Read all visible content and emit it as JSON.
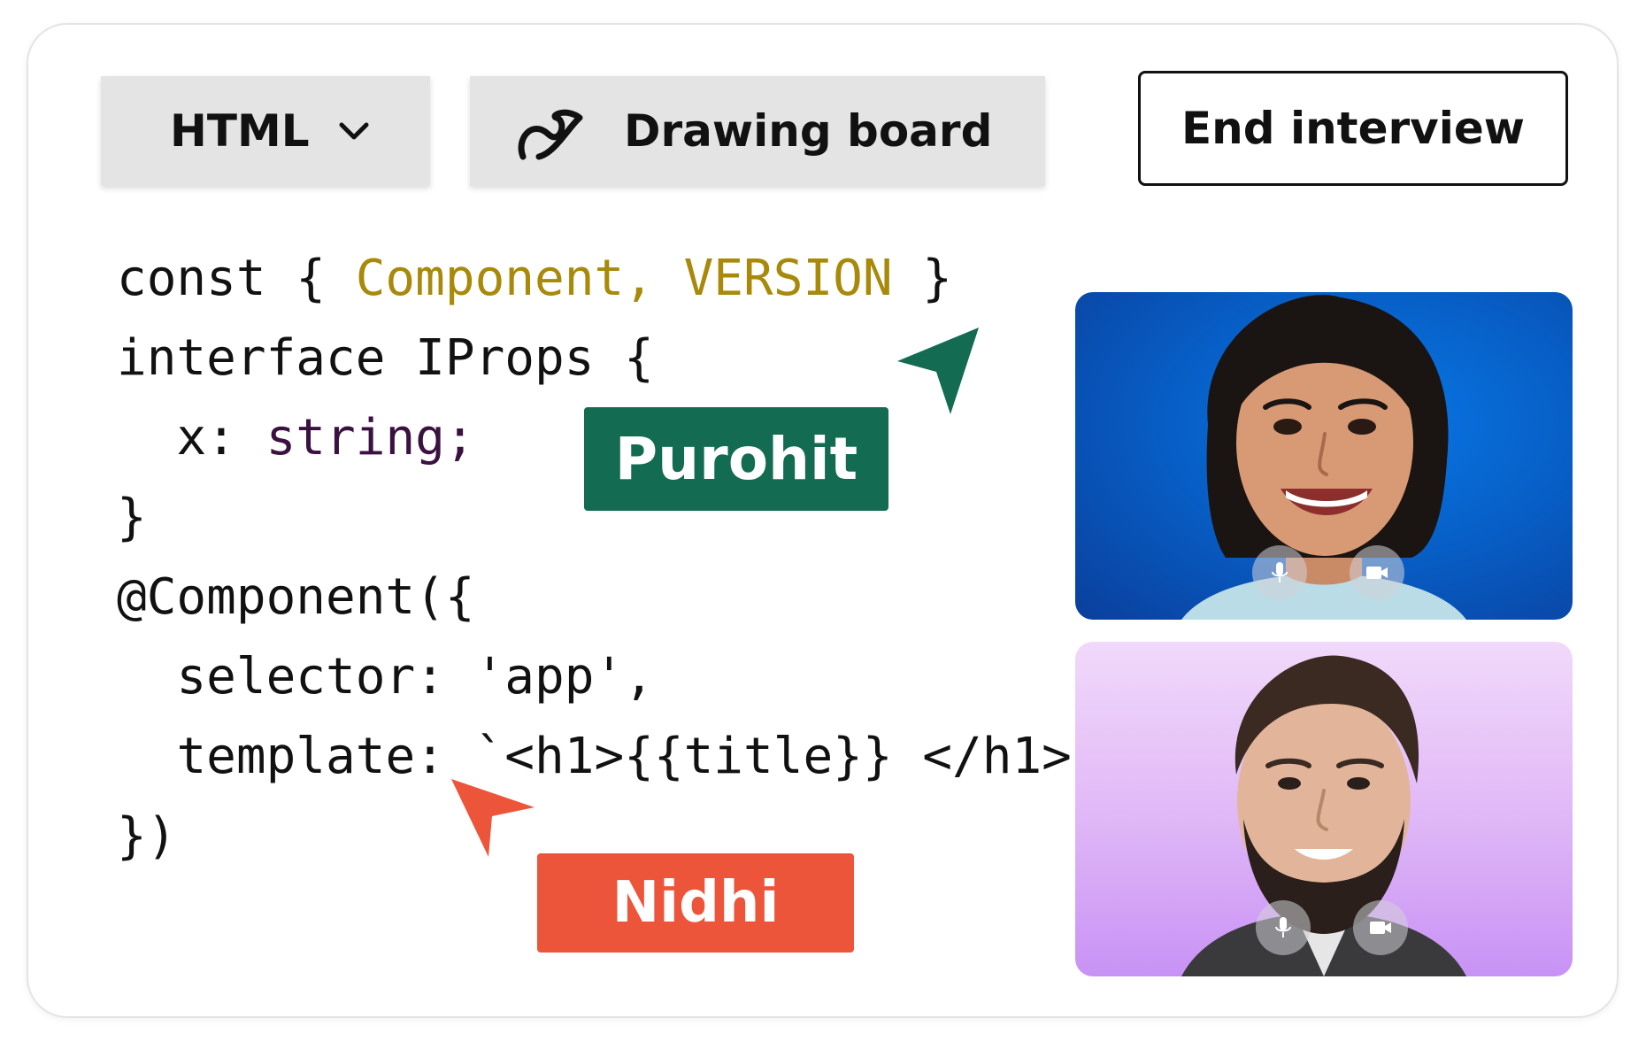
{
  "toolbar": {
    "language_label": "HTML",
    "drawing_board_label": "Drawing board",
    "end_interview_label": "End interview"
  },
  "code_lines": [
    {
      "indent": "",
      "parts": [
        {
          "t": "const { "
        },
        {
          "t": "Component, VERSION",
          "c": "kw-yellow"
        },
        {
          "t": " }"
        }
      ]
    },
    {
      "indent": "",
      "parts": [
        {
          "t": "interface IProps {"
        }
      ]
    },
    {
      "indent": "  ",
      "parts": [
        {
          "t": "x: "
        },
        {
          "t": "string;",
          "c": "kw-purple"
        }
      ]
    },
    {
      "indent": "",
      "parts": [
        {
          "t": "}"
        }
      ]
    },
    {
      "indent": "",
      "parts": [
        {
          "t": "@Component({"
        }
      ]
    },
    {
      "indent": "  ",
      "parts": [
        {
          "t": "selector: 'app',"
        }
      ]
    },
    {
      "indent": "  ",
      "parts": [
        {
          "t": "template: `<h1>{{title}} </h1>"
        }
      ]
    },
    {
      "indent": "",
      "parts": [
        {
          "t": "})"
        }
      ]
    }
  ],
  "cursors": {
    "green_name": "Purohit",
    "red_name": "Nidhi",
    "green_color": "#136b52",
    "red_color": "#ec5539"
  },
  "videos": [
    {
      "participant": "woman",
      "icons": [
        "mic-icon",
        "camera-icon"
      ]
    },
    {
      "participant": "man",
      "icons": [
        "mic-icon",
        "camera-icon"
      ]
    }
  ]
}
